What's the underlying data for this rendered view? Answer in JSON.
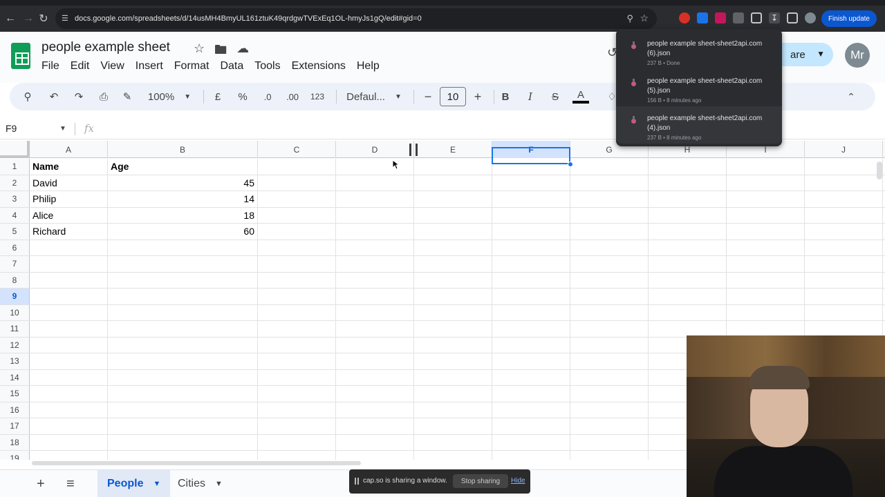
{
  "browser": {
    "url": "docs.google.com/spreadsheets/d/14usMH4BmyUL161ztuK49qrdgwTVExEq1OL-hmyJs1gQ/edit#gid=0",
    "finish_update_label": "Finish update"
  },
  "doc": {
    "title": "people example sheet"
  },
  "menu": [
    "File",
    "Edit",
    "View",
    "Insert",
    "Format",
    "Data",
    "Tools",
    "Extensions",
    "Help"
  ],
  "header": {
    "share_label": "are",
    "avatar_initials": "Mr"
  },
  "toolbar": {
    "zoom": "100%",
    "currency": "£",
    "percent": "%",
    "dec_decrease": ".0",
    "dec_increase": ".00",
    "number_format": "123",
    "font": "Defaul...",
    "font_size": "10",
    "bold": "B",
    "italic": "I",
    "strike": "S",
    "text_color": "A"
  },
  "formula_bar": {
    "cell_ref": "F9",
    "fx": "fx"
  },
  "grid": {
    "columns": [
      "A",
      "B",
      "C",
      "D",
      "E",
      "F",
      "G",
      "H",
      "I",
      "J"
    ],
    "selected_column": "F",
    "selected_row": "9",
    "rows": [
      "1",
      "2",
      "3",
      "4",
      "5",
      "6",
      "7",
      "8",
      "9",
      "10",
      "11",
      "12",
      "13",
      "14",
      "15",
      "16",
      "17",
      "18",
      "19"
    ],
    "data": [
      [
        "Name",
        "Age"
      ],
      [
        "David",
        "45"
      ],
      [
        "Philip",
        "14"
      ],
      [
        "Alice",
        "18"
      ],
      [
        "Richard",
        "60"
      ]
    ]
  },
  "sheets": {
    "tabs": [
      "People",
      "Cities"
    ],
    "active": "People"
  },
  "downloads": [
    {
      "name": "people example sheet-sheet2api.com (6).json",
      "meta": "237 B • Done"
    },
    {
      "name": "people example sheet-sheet2api.com (5).json",
      "meta": "156 B • 8 minutes ago"
    },
    {
      "name": "people example sheet-sheet2api.com (4).json",
      "meta": "237 B • 8 minutes ago"
    }
  ],
  "sharing_bar": {
    "text": "cap.so is sharing a window.",
    "stop_label": "Stop sharing",
    "hide_label": "Hide"
  },
  "colors": {
    "accent": "#0b57d0",
    "selection": "#1a73e8",
    "sheets_green": "#0f9d58"
  }
}
